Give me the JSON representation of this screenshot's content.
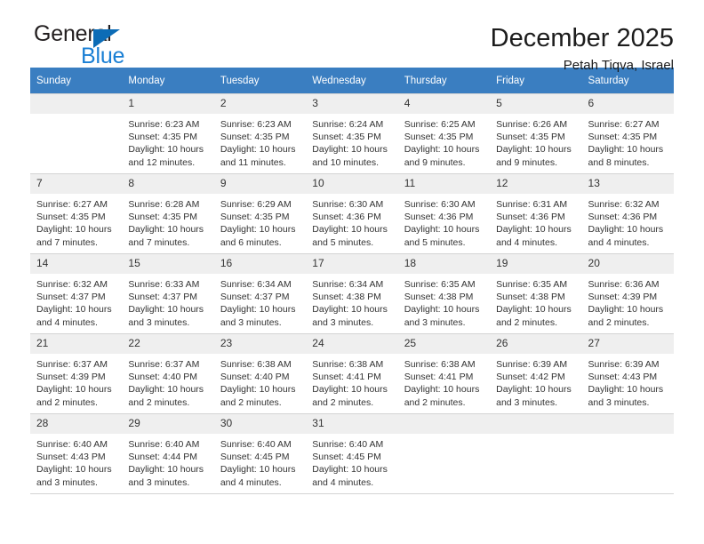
{
  "brand": {
    "word1": "General",
    "word2": "Blue",
    "triangle_color": "#0c6cb6",
    "blue_color": "#1a7fd4"
  },
  "header": {
    "title": "December 2025",
    "subtitle": "Petah Tiqva, Israel"
  },
  "calendar": {
    "header_bg": "#3a7ec1",
    "daynum_bg": "#efefef",
    "weekdays": [
      "Sunday",
      "Monday",
      "Tuesday",
      "Wednesday",
      "Thursday",
      "Friday",
      "Saturday"
    ],
    "weeks": [
      [
        {
          "day": "",
          "sunrise": "",
          "sunset": "",
          "daylight": "",
          "empty": true
        },
        {
          "day": "1",
          "sunrise": "Sunrise: 6:23 AM",
          "sunset": "Sunset: 4:35 PM",
          "daylight": "Daylight: 10 hours and 12 minutes."
        },
        {
          "day": "2",
          "sunrise": "Sunrise: 6:23 AM",
          "sunset": "Sunset: 4:35 PM",
          "daylight": "Daylight: 10 hours and 11 minutes."
        },
        {
          "day": "3",
          "sunrise": "Sunrise: 6:24 AM",
          "sunset": "Sunset: 4:35 PM",
          "daylight": "Daylight: 10 hours and 10 minutes."
        },
        {
          "day": "4",
          "sunrise": "Sunrise: 6:25 AM",
          "sunset": "Sunset: 4:35 PM",
          "daylight": "Daylight: 10 hours and 9 minutes."
        },
        {
          "day": "5",
          "sunrise": "Sunrise: 6:26 AM",
          "sunset": "Sunset: 4:35 PM",
          "daylight": "Daylight: 10 hours and 9 minutes."
        },
        {
          "day": "6",
          "sunrise": "Sunrise: 6:27 AM",
          "sunset": "Sunset: 4:35 PM",
          "daylight": "Daylight: 10 hours and 8 minutes."
        }
      ],
      [
        {
          "day": "7",
          "sunrise": "Sunrise: 6:27 AM",
          "sunset": "Sunset: 4:35 PM",
          "daylight": "Daylight: 10 hours and 7 minutes."
        },
        {
          "day": "8",
          "sunrise": "Sunrise: 6:28 AM",
          "sunset": "Sunset: 4:35 PM",
          "daylight": "Daylight: 10 hours and 7 minutes."
        },
        {
          "day": "9",
          "sunrise": "Sunrise: 6:29 AM",
          "sunset": "Sunset: 4:35 PM",
          "daylight": "Daylight: 10 hours and 6 minutes."
        },
        {
          "day": "10",
          "sunrise": "Sunrise: 6:30 AM",
          "sunset": "Sunset: 4:36 PM",
          "daylight": "Daylight: 10 hours and 5 minutes."
        },
        {
          "day": "11",
          "sunrise": "Sunrise: 6:30 AM",
          "sunset": "Sunset: 4:36 PM",
          "daylight": "Daylight: 10 hours and 5 minutes."
        },
        {
          "day": "12",
          "sunrise": "Sunrise: 6:31 AM",
          "sunset": "Sunset: 4:36 PM",
          "daylight": "Daylight: 10 hours and 4 minutes."
        },
        {
          "day": "13",
          "sunrise": "Sunrise: 6:32 AM",
          "sunset": "Sunset: 4:36 PM",
          "daylight": "Daylight: 10 hours and 4 minutes."
        }
      ],
      [
        {
          "day": "14",
          "sunrise": "Sunrise: 6:32 AM",
          "sunset": "Sunset: 4:37 PM",
          "daylight": "Daylight: 10 hours and 4 minutes."
        },
        {
          "day": "15",
          "sunrise": "Sunrise: 6:33 AM",
          "sunset": "Sunset: 4:37 PM",
          "daylight": "Daylight: 10 hours and 3 minutes."
        },
        {
          "day": "16",
          "sunrise": "Sunrise: 6:34 AM",
          "sunset": "Sunset: 4:37 PM",
          "daylight": "Daylight: 10 hours and 3 minutes."
        },
        {
          "day": "17",
          "sunrise": "Sunrise: 6:34 AM",
          "sunset": "Sunset: 4:38 PM",
          "daylight": "Daylight: 10 hours and 3 minutes."
        },
        {
          "day": "18",
          "sunrise": "Sunrise: 6:35 AM",
          "sunset": "Sunset: 4:38 PM",
          "daylight": "Daylight: 10 hours and 3 minutes."
        },
        {
          "day": "19",
          "sunrise": "Sunrise: 6:35 AM",
          "sunset": "Sunset: 4:38 PM",
          "daylight": "Daylight: 10 hours and 2 minutes."
        },
        {
          "day": "20",
          "sunrise": "Sunrise: 6:36 AM",
          "sunset": "Sunset: 4:39 PM",
          "daylight": "Daylight: 10 hours and 2 minutes."
        }
      ],
      [
        {
          "day": "21",
          "sunrise": "Sunrise: 6:37 AM",
          "sunset": "Sunset: 4:39 PM",
          "daylight": "Daylight: 10 hours and 2 minutes."
        },
        {
          "day": "22",
          "sunrise": "Sunrise: 6:37 AM",
          "sunset": "Sunset: 4:40 PM",
          "daylight": "Daylight: 10 hours and 2 minutes."
        },
        {
          "day": "23",
          "sunrise": "Sunrise: 6:38 AM",
          "sunset": "Sunset: 4:40 PM",
          "daylight": "Daylight: 10 hours and 2 minutes."
        },
        {
          "day": "24",
          "sunrise": "Sunrise: 6:38 AM",
          "sunset": "Sunset: 4:41 PM",
          "daylight": "Daylight: 10 hours and 2 minutes."
        },
        {
          "day": "25",
          "sunrise": "Sunrise: 6:38 AM",
          "sunset": "Sunset: 4:41 PM",
          "daylight": "Daylight: 10 hours and 2 minutes."
        },
        {
          "day": "26",
          "sunrise": "Sunrise: 6:39 AM",
          "sunset": "Sunset: 4:42 PM",
          "daylight": "Daylight: 10 hours and 3 minutes."
        },
        {
          "day": "27",
          "sunrise": "Sunrise: 6:39 AM",
          "sunset": "Sunset: 4:43 PM",
          "daylight": "Daylight: 10 hours and 3 minutes."
        }
      ],
      [
        {
          "day": "28",
          "sunrise": "Sunrise: 6:40 AM",
          "sunset": "Sunset: 4:43 PM",
          "daylight": "Daylight: 10 hours and 3 minutes."
        },
        {
          "day": "29",
          "sunrise": "Sunrise: 6:40 AM",
          "sunset": "Sunset: 4:44 PM",
          "daylight": "Daylight: 10 hours and 3 minutes."
        },
        {
          "day": "30",
          "sunrise": "Sunrise: 6:40 AM",
          "sunset": "Sunset: 4:45 PM",
          "daylight": "Daylight: 10 hours and 4 minutes."
        },
        {
          "day": "31",
          "sunrise": "Sunrise: 6:40 AM",
          "sunset": "Sunset: 4:45 PM",
          "daylight": "Daylight: 10 hours and 4 minutes."
        },
        {
          "day": "",
          "sunrise": "",
          "sunset": "",
          "daylight": "",
          "empty": true
        },
        {
          "day": "",
          "sunrise": "",
          "sunset": "",
          "daylight": "",
          "empty": true
        },
        {
          "day": "",
          "sunrise": "",
          "sunset": "",
          "daylight": "",
          "empty": true
        }
      ]
    ]
  }
}
